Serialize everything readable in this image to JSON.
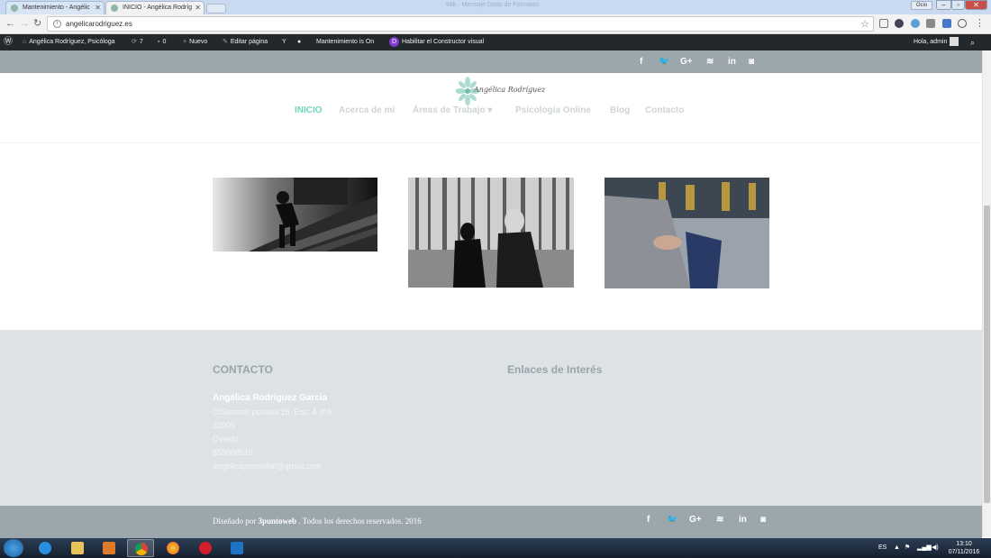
{
  "browser": {
    "tabs": [
      {
        "title": "Mantenimiento - Angélic"
      },
      {
        "title": "INICIO - Angélica Rodríg"
      }
    ],
    "window_title": "Blik · Mensaje Dado de Formatos",
    "user_badge": "Ocio",
    "url": "angelicarodriguez.es"
  },
  "adminbar": {
    "site_name": "Angélica Rodríguez, Psicóloga",
    "updates_count": "7",
    "comments_count": "0",
    "new_label": "Nuevo",
    "edit_label": "Editar página",
    "maintenance_label": "Mantenimiento is On",
    "builder_label": "Habilitar el Constructor visual",
    "greeting": "Hola, admin"
  },
  "header": {
    "logo_text": "Angélica Rodríguez",
    "menu": [
      {
        "label": "INICIO",
        "active": true
      },
      {
        "label": "Acerca de mi"
      },
      {
        "label": "Áreas de Trabajo ▾"
      },
      {
        "label": "Psicología Online"
      },
      {
        "label": "Blog"
      },
      {
        "label": "Contacto"
      }
    ]
  },
  "social_icons": [
    "facebook-icon",
    "twitter-icon",
    "google-plus-icon",
    "rss-icon",
    "linkedin-icon",
    "instagram-icon"
  ],
  "social_glyphs": {
    "facebook": "f",
    "twitter": "🐦",
    "gplus": "G+",
    "rss": "≋",
    "linkedin": "in",
    "instagram": "◙"
  },
  "footer": {
    "contact_heading": "CONTACTO",
    "links_heading": "Enlaces de Interés",
    "name": "Angélica Rodríguez García",
    "address": "C/Serrano posada 15, Esc. A 3ºA",
    "postal_code": "33009",
    "city": "Oviedo",
    "phone": "653008516",
    "email": "angelicapsicovital@gmail.com"
  },
  "bottom": {
    "designed_by": "Diseñado por",
    "company": "3puntoweb",
    "rights": ". Todos los derechos reservados. 2016"
  },
  "taskbar": {
    "lang": "ES",
    "time": "13:10",
    "date": "07/11/2016"
  },
  "colors": {
    "accent": "#6fd6be",
    "topbar": "#9ba6ad",
    "footer_bg": "#dde2e5"
  }
}
